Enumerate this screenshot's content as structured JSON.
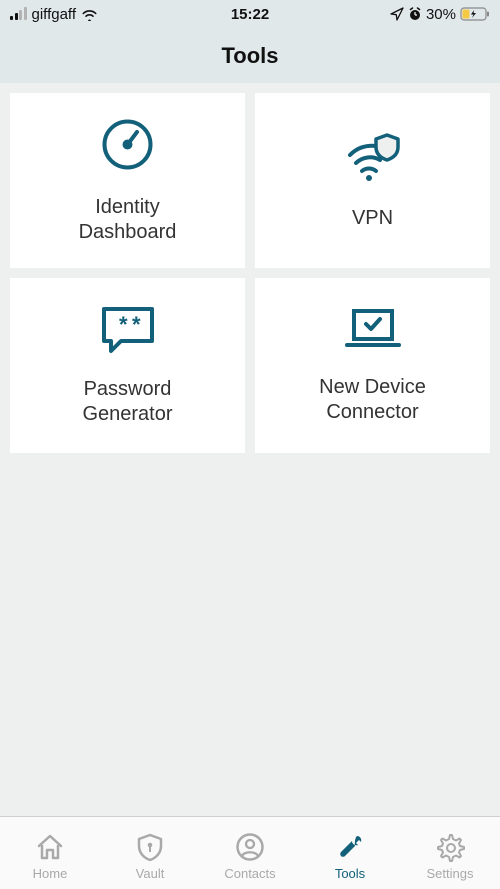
{
  "statusBar": {
    "carrier": "giffgaff",
    "time": "15:22",
    "batteryPercent": "30%"
  },
  "header": {
    "title": "Tools"
  },
  "tiles": {
    "identityDashboard": "Identity\nDashboard",
    "vpn": "VPN",
    "passwordGenerator": "Password\nGenerator",
    "newDeviceConnector": "New Device\nConnector"
  },
  "tabs": {
    "home": "Home",
    "vault": "Vault",
    "contacts": "Contacts",
    "tools": "Tools",
    "settings": "Settings"
  },
  "colors": {
    "accent": "#126079",
    "headerBg": "#e1e8e9",
    "pageBg": "#eef0f0",
    "inactiveTab": "#a9a9a9"
  }
}
